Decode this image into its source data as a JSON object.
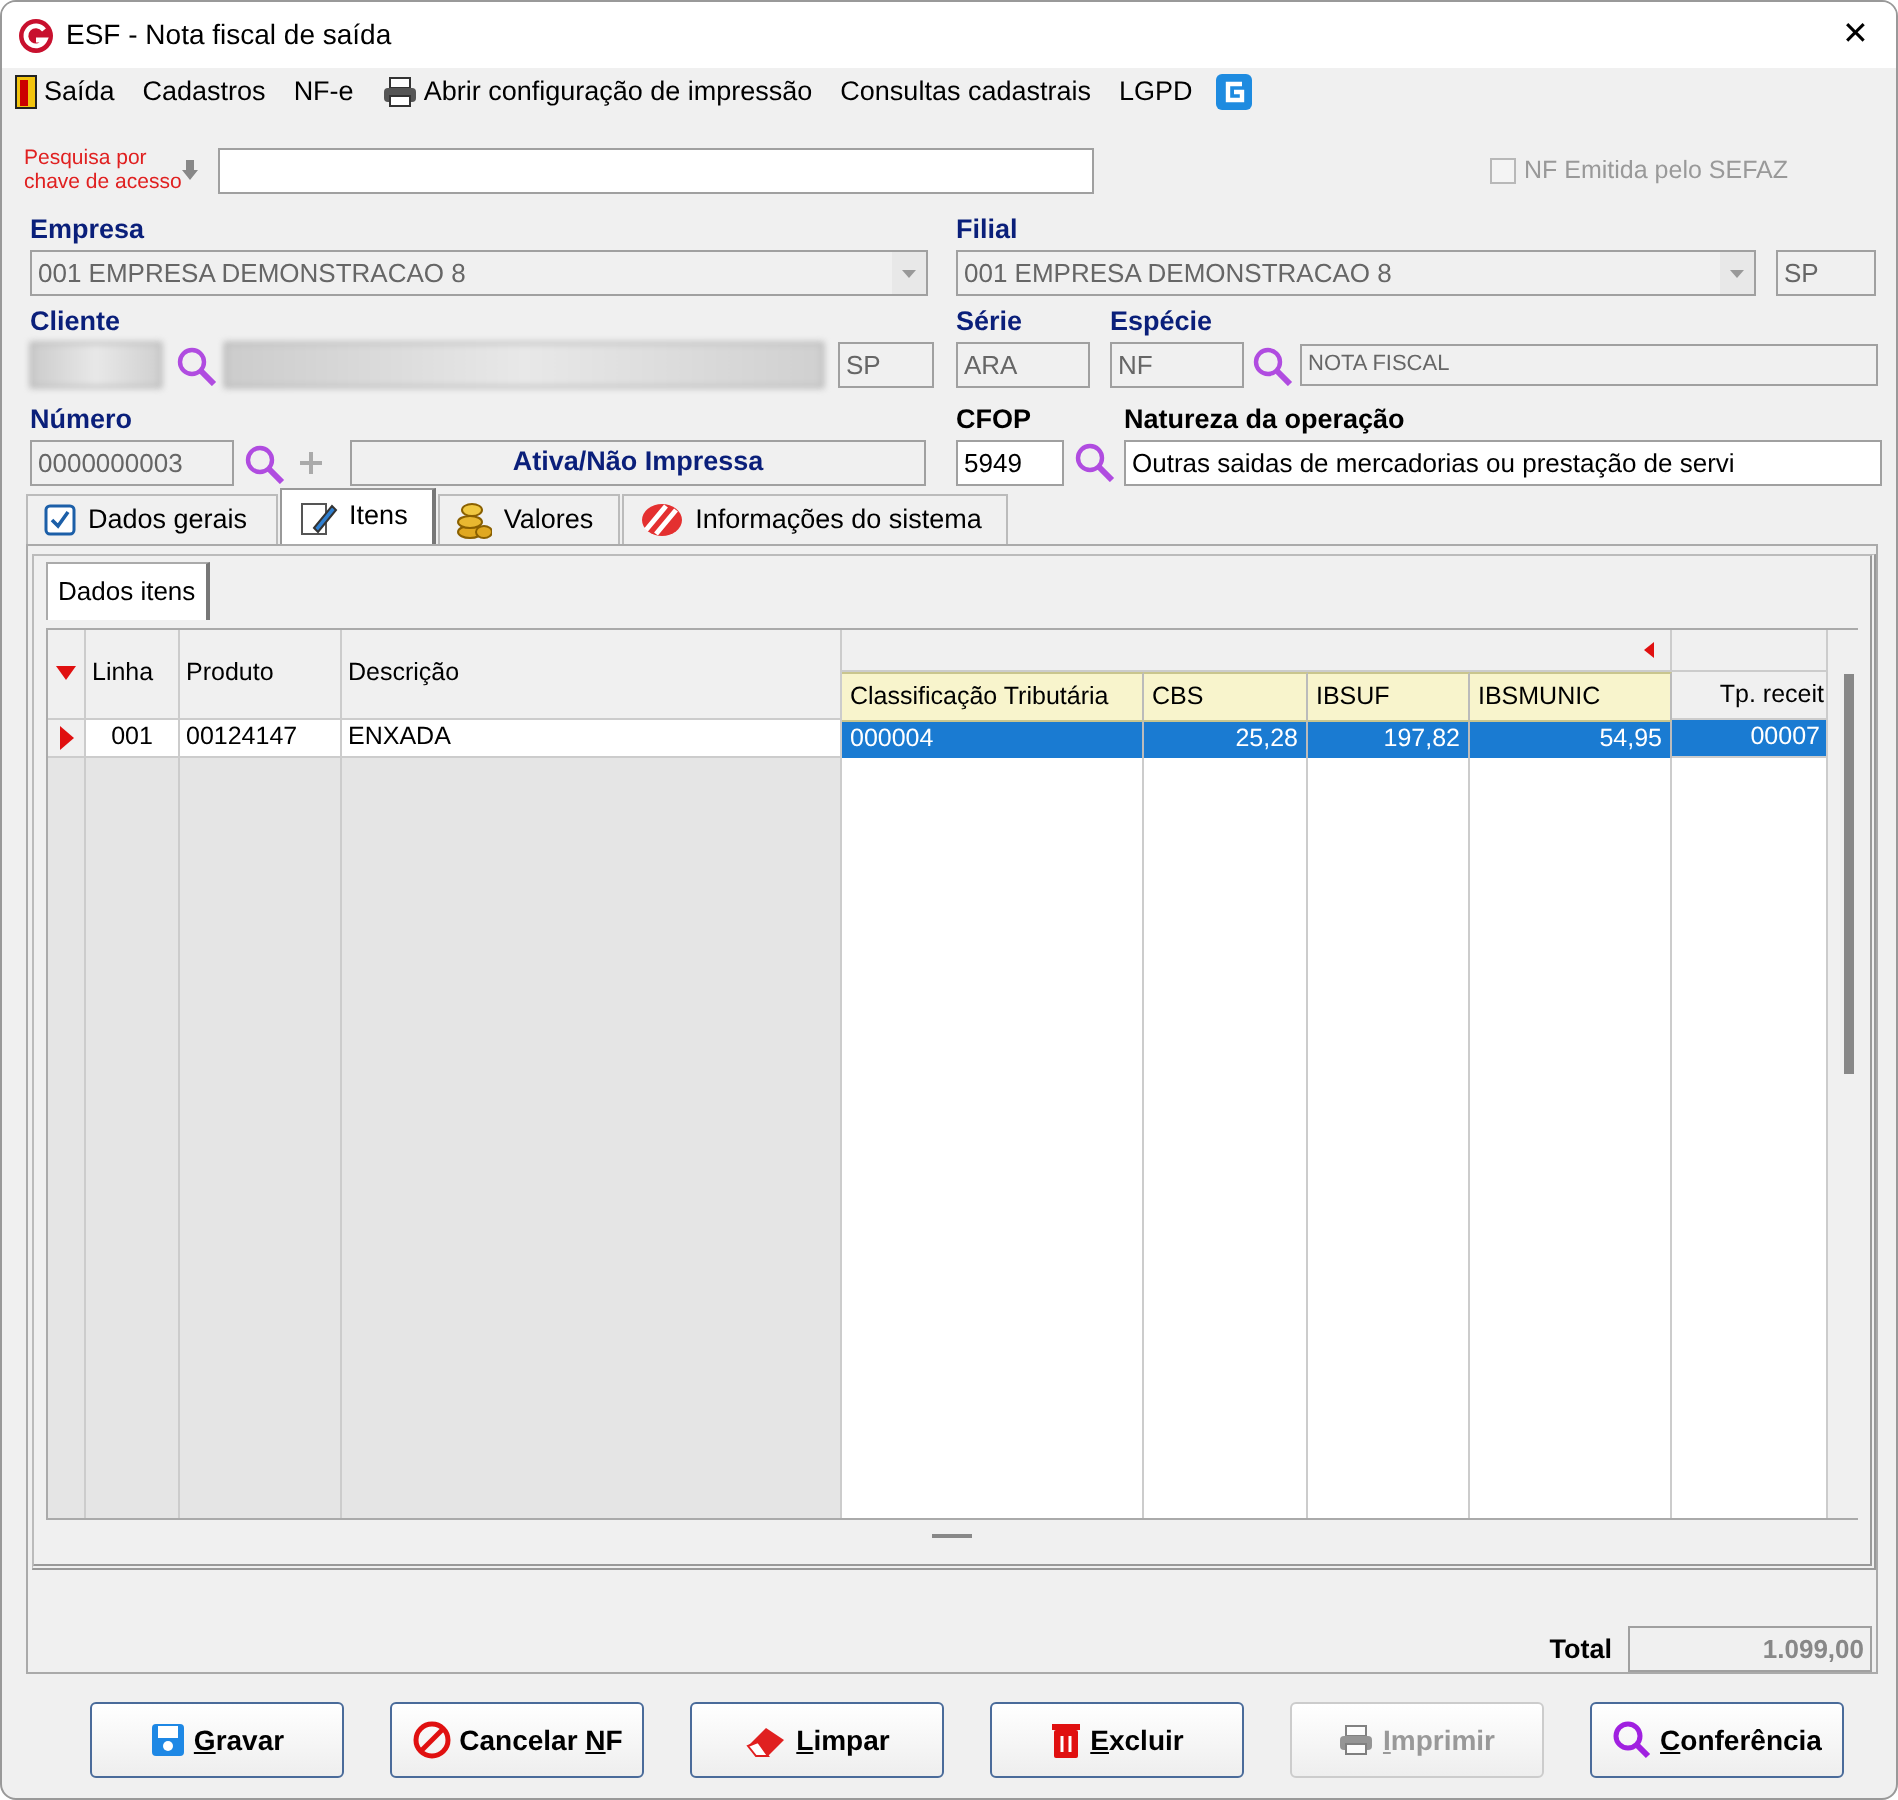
{
  "window": {
    "title": "ESF - Nota fiscal de saída",
    "close": "✕"
  },
  "menu": [
    {
      "label": "Saída"
    },
    {
      "label": "Cadastros"
    },
    {
      "label": "NF-e"
    },
    {
      "label": "Abrir configuração de impressão"
    },
    {
      "label": "Consultas cadastrais"
    },
    {
      "label": "LGPD"
    }
  ],
  "search": {
    "label_line1": "Pesquisa por",
    "label_line2": "chave de acesso"
  },
  "sefaz_checkbox": {
    "label": "NF Emitida pelo SEFAZ",
    "checked": false,
    "disabled": true
  },
  "empresa": {
    "label": "Empresa",
    "value": "001 EMPRESA DEMONSTRACAO 8"
  },
  "filial": {
    "label": "Filial",
    "value": "001 EMPRESA DEMONSTRACAO 8",
    "uf": "SP"
  },
  "cliente": {
    "label": "Cliente",
    "uf": "SP"
  },
  "serie": {
    "label": "Série",
    "value": "ARA"
  },
  "especie": {
    "label": "Espécie",
    "value": "NF",
    "description": "NOTA FISCAL"
  },
  "numero": {
    "label": "Número",
    "value": "0000000003",
    "status": "Ativa/Não Impressa"
  },
  "cfop": {
    "label": "CFOP",
    "value": "5949"
  },
  "natureza": {
    "label": "Natureza da operação",
    "value": "Outras saidas de mercadorias ou prestação de servi"
  },
  "tabs": [
    {
      "label": "Dados gerais",
      "selected": false
    },
    {
      "label": "Itens",
      "selected": true
    },
    {
      "label": "Valores",
      "selected": false
    },
    {
      "label": "Informações do sistema",
      "selected": false
    }
  ],
  "subtab": {
    "label": "Dados itens",
    "selected": true
  },
  "grid": {
    "columns": [
      "Linha",
      "Produto",
      "Descrição"
    ],
    "popup_columns": [
      "Classificação Tributária",
      "CBS",
      "IBSUF",
      "IBSMUNIC"
    ],
    "column_9": "Tp. receit",
    "rows": [
      {
        "selected": true,
        "cells": [
          "001",
          "00124147",
          "ENXADA"
        ],
        "popup_cells": [
          "000004",
          "25,28",
          "197,82",
          "54,95"
        ],
        "column_9": "00007"
      }
    ]
  },
  "total": {
    "label": "Total",
    "value": "1.099,00"
  },
  "buttons": [
    {
      "key": "G",
      "after": "ravar",
      "disabled": false
    },
    {
      "before": "Cancelar ",
      "key": "N",
      "after": "F",
      "disabled": false
    },
    {
      "key": "L",
      "after": "impar",
      "disabled": false
    },
    {
      "key": "E",
      "after": "xcluir",
      "disabled": false
    },
    {
      "key": "I",
      "after": "mprimir",
      "disabled": true
    },
    {
      "key": "C",
      "after": "onferência",
      "disabled": false
    }
  ]
}
